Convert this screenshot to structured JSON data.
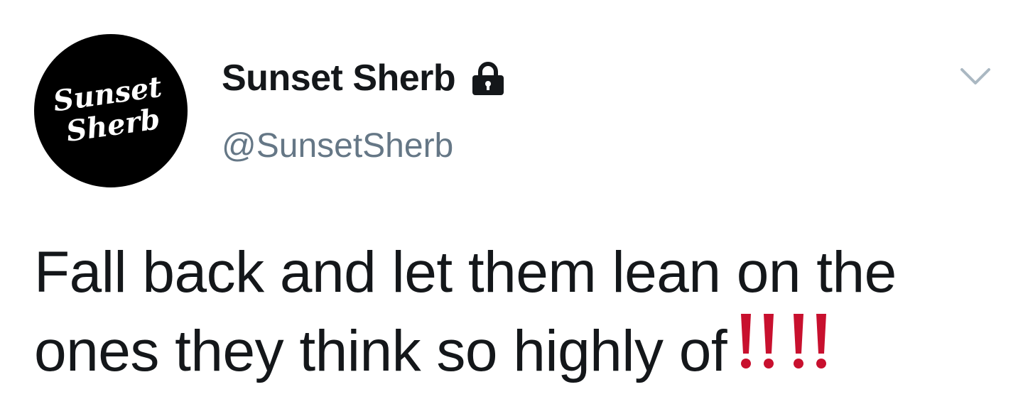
{
  "tweet": {
    "avatar": {
      "logo_text": [
        "Sunset",
        "Sherb"
      ]
    },
    "display_name": "Sunset Sherb",
    "protected_icon": "lock-icon",
    "handle": "@SunsetSherb",
    "menu_icon": "chevron-down-icon",
    "text_line1": "Fall back and let them lean on the",
    "text_line2": "ones they think so highly of",
    "emoji": [
      "double-exclamation-icon",
      "double-exclamation-icon"
    ]
  },
  "colors": {
    "text": "#14171a",
    "secondary_text": "#657786",
    "caret": "#aab8c2",
    "emoji_red": "#c8102e",
    "avatar_bg": "#000000"
  }
}
